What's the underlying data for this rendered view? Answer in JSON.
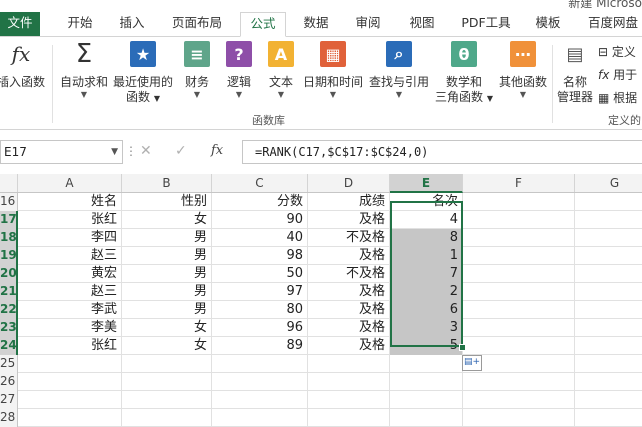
{
  "window": {
    "title_fragment": "新建 Microso"
  },
  "tabs": [
    {
      "label": "文件",
      "active": false,
      "file": true
    },
    {
      "label": "开始"
    },
    {
      "label": "插入"
    },
    {
      "label": "页面布局"
    },
    {
      "label": "公式",
      "active": true
    },
    {
      "label": "数据"
    },
    {
      "label": "审阅"
    },
    {
      "label": "视图"
    },
    {
      "label": "PDF工具"
    },
    {
      "label": "模板"
    },
    {
      "label": "百度网盘"
    }
  ],
  "ribbon": {
    "buttons": [
      {
        "line1": "插入函数",
        "line2": "",
        "icon": "insert-function-icon"
      },
      {
        "line1": "自动求和",
        "line2": "",
        "icon": "autosum-icon"
      },
      {
        "line1": "最近使用的",
        "line2": "函数",
        "icon": "recent-functions-icon"
      },
      {
        "line1": "财务",
        "line2": "",
        "icon": "financial-icon"
      },
      {
        "line1": "逻辑",
        "line2": "",
        "icon": "logical-icon"
      },
      {
        "line1": "文本",
        "line2": "",
        "icon": "text-icon"
      },
      {
        "line1": "日期和时间",
        "line2": "",
        "icon": "date-time-icon"
      },
      {
        "line1": "查找与引用",
        "line2": "",
        "icon": "lookup-icon"
      },
      {
        "line1": "数学和",
        "line2": "三角函数",
        "icon": "math-trig-icon"
      },
      {
        "line1": "其他函数",
        "line2": "",
        "icon": "more-functions-icon"
      },
      {
        "line1": "名称",
        "line2": "管理器",
        "icon": "name-manager-icon"
      }
    ],
    "small_items": [
      "定义",
      "用于",
      "根据"
    ],
    "group_label": "函数库",
    "group_label_2": "定义的"
  },
  "formula_bar": {
    "name_box": "E17",
    "fx": "fx",
    "formula": "=RANK(C17,$C$17:$C$24,0)"
  },
  "columns": [
    "A",
    "B",
    "C",
    "D",
    "E",
    "F",
    "G"
  ],
  "selected_column": "E",
  "rows": [
    {
      "num": "16",
      "cells": [
        "姓名",
        "性别",
        "分数",
        "成绩",
        "名次"
      ],
      "selected": false
    },
    {
      "num": "17",
      "cells": [
        "张红",
        "女",
        "90",
        "及格",
        "4"
      ],
      "selected": true
    },
    {
      "num": "18",
      "cells": [
        "李四",
        "男",
        "40",
        "不及格",
        "8"
      ],
      "selected": true
    },
    {
      "num": "19",
      "cells": [
        "赵三",
        "男",
        "98",
        "及格",
        "1"
      ],
      "selected": true
    },
    {
      "num": "20",
      "cells": [
        "黄宏",
        "男",
        "50",
        "不及格",
        "7"
      ],
      "selected": true
    },
    {
      "num": "21",
      "cells": [
        "赵三",
        "男",
        "97",
        "及格",
        "2"
      ],
      "selected": true
    },
    {
      "num": "22",
      "cells": [
        "李武",
        "男",
        "80",
        "及格",
        "6"
      ],
      "selected": true
    },
    {
      "num": "23",
      "cells": [
        "李美",
        "女",
        "96",
        "及格",
        "3"
      ],
      "selected": true
    },
    {
      "num": "24",
      "cells": [
        "张红",
        "女",
        "89",
        "及格",
        "5"
      ],
      "selected": true
    },
    {
      "num": "25",
      "cells": [
        "",
        "",
        "",
        "",
        ""
      ],
      "selected": false
    },
    {
      "num": "26",
      "cells": [
        "",
        "",
        "",
        "",
        ""
      ],
      "selected": false
    },
    {
      "num": "27",
      "cells": [
        "",
        "",
        "",
        "",
        ""
      ],
      "selected": false
    },
    {
      "num": "28",
      "cells": [
        "",
        "",
        "",
        "",
        ""
      ],
      "selected": false
    }
  ],
  "colors": {
    "accent": "#217346",
    "selection_fill": "#c6c6c6"
  }
}
